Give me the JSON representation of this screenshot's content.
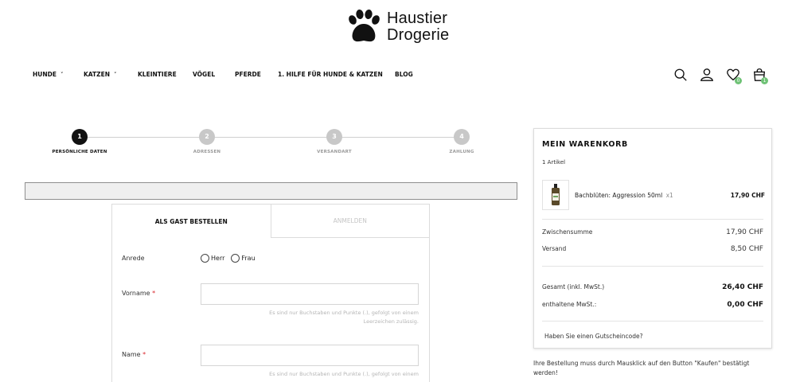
{
  "brand": {
    "line1": "Haustier",
    "line2": "Drogerie"
  },
  "nav": {
    "items": [
      {
        "label": "HUNDE",
        "has_dropdown": true
      },
      {
        "label": "KATZEN",
        "has_dropdown": true
      },
      {
        "label": "KLEINTIERE",
        "has_dropdown": false
      },
      {
        "label": "VÖGEL",
        "has_dropdown": false
      },
      {
        "label": "PFERDE",
        "has_dropdown": false
      },
      {
        "label": "1. HILFE FÜR HUNDE & KATZEN",
        "has_dropdown": false
      },
      {
        "label": "BLOG",
        "has_dropdown": false
      }
    ],
    "chevron": "˅"
  },
  "header_icons": {
    "search": "search-icon",
    "account": "user-icon",
    "wishlist": "heart-icon",
    "wishlist_badge": "0",
    "cart": "shopping-bag-icon",
    "cart_badge": "1",
    "badge_color": "#6fc276"
  },
  "stepper": {
    "steps": [
      {
        "num": "1",
        "label": "PERSÖNLICHE DATEN",
        "active": true
      },
      {
        "num": "2",
        "label": "ADRESSEN",
        "active": false
      },
      {
        "num": "3",
        "label": "VERSANDART",
        "active": false
      },
      {
        "num": "4",
        "label": "ZAHLUNG",
        "active": false
      }
    ]
  },
  "form": {
    "tab_guest": "ALS GAST BESTELLEN",
    "tab_login": "ANMELDEN",
    "salutation_label": "Anrede",
    "salutation_options": [
      "Herr",
      "Frau"
    ],
    "firstname_label": "Vorname",
    "lastname_label": "Name",
    "required_marker": "*",
    "hint_line1": "Es sind nur Buchstaben und Punkte (.), gefolgt von einem",
    "hint_line2": "Leerzeichen zulässig.",
    "firstname_value": "",
    "lastname_value": ""
  },
  "cart": {
    "title": "MEIN WARENKORB",
    "count": "1 Artikel",
    "item": {
      "name": "Bachblüten: Aggression 50ml",
      "qty": "x1",
      "price": "17,90 CHF"
    },
    "subtotal_label": "Zwischensumme",
    "subtotal_value": "17,90 CHF",
    "shipping_label": "Versand",
    "shipping_value": "8,50 CHF",
    "total_label": "Gesamt (inkl. MwSt.)",
    "total_value": "26,40 CHF",
    "tax_label": "enthaltene MwSt.:",
    "tax_value": "0,00 CHF",
    "coupon_text": "Haben Sie einen Gutscheincode?"
  },
  "notice": "Ihre Bestellung muss durch Mausklick auf den Button \"Kaufen\" bestätigt werden!"
}
